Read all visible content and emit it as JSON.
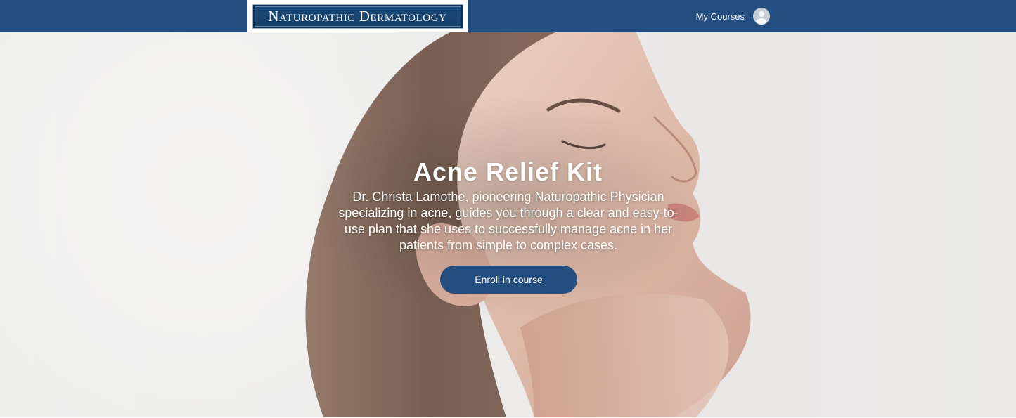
{
  "navbar": {
    "logo_text": "Naturopathic Dermatology",
    "my_courses_label": "My Courses",
    "avatar_icon": "user-avatar-icon"
  },
  "hero": {
    "title": "Acne Relief Kit",
    "description": "Dr. Christa Lamothe, pioneering Naturopathic Physician specializing in acne, guides you through a clear and easy-to-use plan that she uses to successfully manage acne in her patients from simple to complex cases.",
    "enroll_label": "Enroll in course",
    "image": "woman-face-profile-photo"
  },
  "colors": {
    "navbar": "#234e7f",
    "button": "#234e7f",
    "text_on_dark": "#ffffff",
    "background": "#ececeb"
  }
}
